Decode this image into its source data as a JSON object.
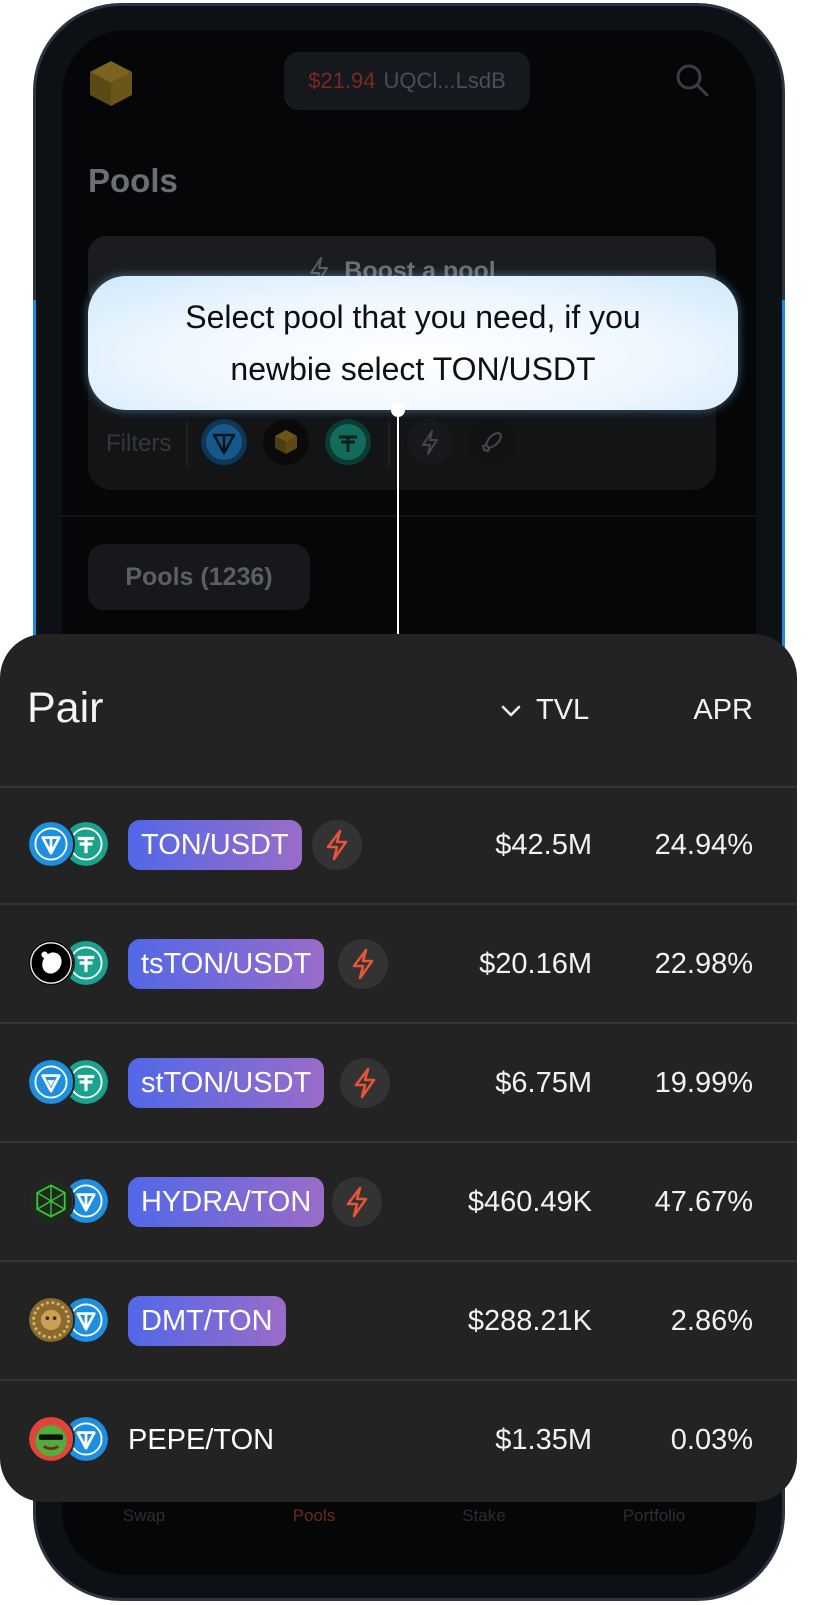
{
  "header": {
    "wallet_balance": "$21.94",
    "wallet_address": "UQCl...LsdB"
  },
  "page": {
    "title": "Pools",
    "boost_label": "Boost a pool",
    "filters_label": "Filters",
    "pools_count_label": "Pools (1236)"
  },
  "tooltip": {
    "text": "Select pool that you need, if you newbie select TON/USDT"
  },
  "table": {
    "pair_header": "Pair",
    "tvl_header": "TVL",
    "apr_header": "APR",
    "rows": [
      {
        "pair": "TON/USDT",
        "tvl": "$42.5M",
        "apr": "24.94%",
        "boosted": true,
        "coins": [
          "ton-icon",
          "usdt-icon"
        ]
      },
      {
        "pair": "tsTON/USDT",
        "tvl": "$20.16M",
        "apr": "22.98%",
        "boosted": true,
        "coins": [
          "tston-icon",
          "usdt-icon"
        ]
      },
      {
        "pair": "stTON/USDT",
        "tvl": "$6.75M",
        "apr": "19.99%",
        "boosted": true,
        "coins": [
          "stton-icon",
          "usdt-icon"
        ]
      },
      {
        "pair": "HYDRA/TON",
        "tvl": "$460.49K",
        "apr": "47.67%",
        "boosted": true,
        "coins": [
          "hydra-icon",
          "ton-icon"
        ]
      },
      {
        "pair": "DMT/TON",
        "tvl": "$288.21K",
        "apr": "2.86%",
        "boosted": false,
        "coins": [
          "dmt-icon",
          "ton-icon"
        ]
      },
      {
        "pair": "PEPE/TON",
        "tvl": "$1.35M",
        "apr": "0.03%",
        "boosted": false,
        "coins": [
          "pepe-icon",
          "ton-icon"
        ]
      }
    ]
  },
  "nav": {
    "items": [
      {
        "label": "Swap"
      },
      {
        "label": "Pools"
      },
      {
        "label": "Stake"
      },
      {
        "label": "Portfolio"
      }
    ]
  },
  "colors": {
    "accent_orange": "#e8553a",
    "badge_gradient_start": "#5268e8",
    "badge_gradient_end": "#9a6cc8",
    "ton_blue": "#1d8ee0",
    "usdt_teal": "#1aa38c"
  }
}
